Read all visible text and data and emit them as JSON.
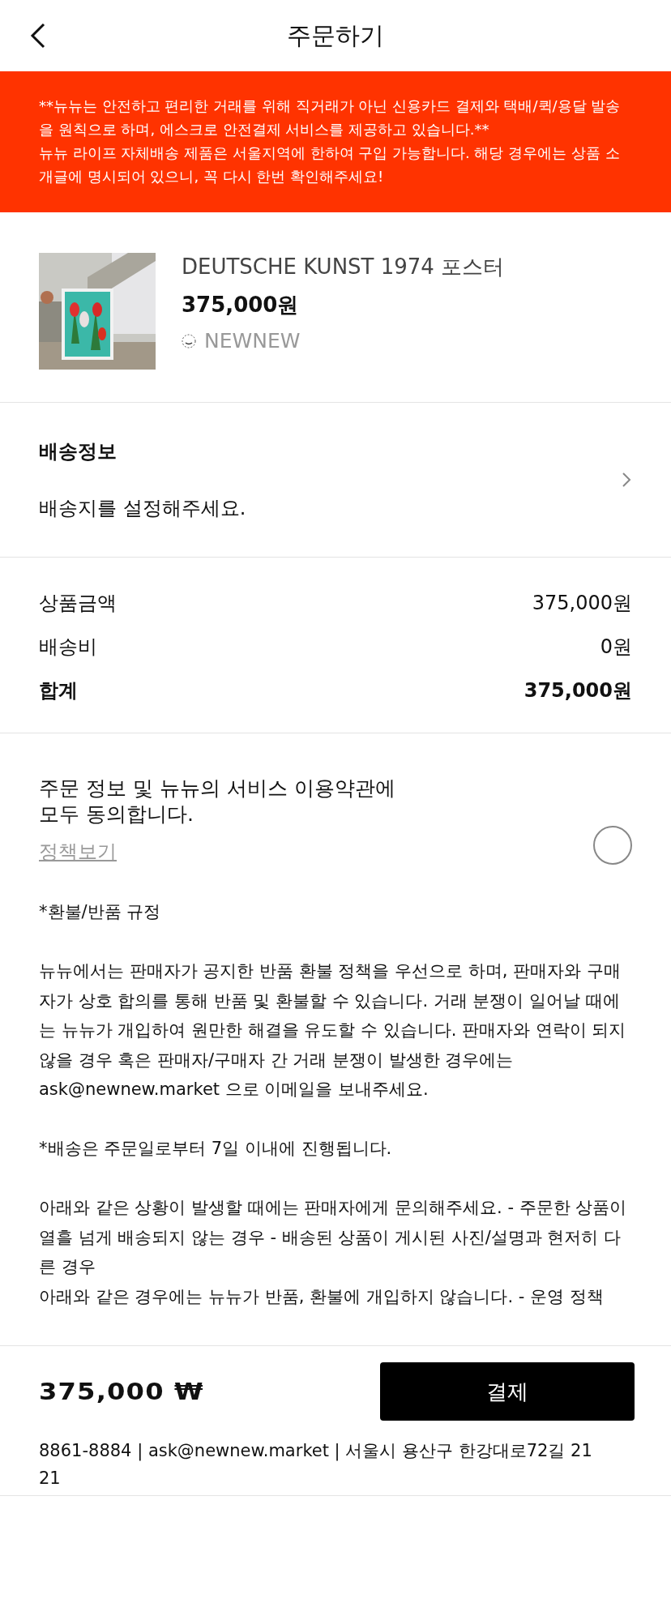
{
  "header": {
    "title": "주문하기"
  },
  "notice": [
    "**뉴뉴는 안전하고 편리한 거래를 위해 직거래가 아닌 신용카드 결제와 택배/퀵/용달 발송을 원칙으로 하며, 에스크로 안전결제 서비스를 제공하고 있습니다.**",
    "뉴뉴 라이프 자체배송 제품은 서울지역에 한하여 구입 가능합니다. 해당 경우에는 상품 소개글에 명시되어 있으니, 꼭 다시 한번 확인해주세요!"
  ],
  "product": {
    "name": "DEUTSCHE KUNST 1974 포스터",
    "price": "375,000원",
    "seller": "NEWNEW"
  },
  "shipping": {
    "title": "배송정보",
    "address_placeholder": "배송지를 설정해주세요."
  },
  "summary": [
    {
      "label": "상품금액",
      "value": "375,000원",
      "kind": "normal"
    },
    {
      "label": "배송비",
      "value": "0원",
      "kind": "normal"
    },
    {
      "label": "합계",
      "value": "375,000원",
      "kind": "total"
    }
  ],
  "agreement": {
    "text": "주문 정보 및 뉴뉴의 서비스 이용약관에\n모두 동의합니다.",
    "link": "정책보기",
    "checked": false
  },
  "terms": [
    "*환불/반품 규정",
    "뉴뉴에서는 판매자가 공지한 반품 환불 정책을 우선으로 하며, 판매자와 구매자가 상호 합의를 통해 반품 및 환불할 수 있습니다. 거래 분쟁이 일어날 때에는 뉴뉴가 개입하여 원만한 해결을 유도할 수 있습니다. 판매자와 연락이 되지 않을 경우 혹은 판매자/구매자 간 거래 분쟁이 발생한 경우에는 ask@newnew.market 으로 이메일을 보내주세요.",
    "*배송은 주문일로부터 7일 이내에 진행됩니다.",
    "아래와 같은 상황이 발생할 때에는 판매자에게 문의해주세요. - 주문한 상품이 열흘 넘게 배송되지 않는 경우 - 배송된 상품이 게시된 사진/설명과 현저히 다른 경우\n아래와 같은 경우에는 뉴뉴가 반품, 환불에 개입하지 않습니다. - 운영 정책"
  ],
  "bottom_bar": {
    "total": "375,000 ₩",
    "pay_button": "결제"
  },
  "footer": {
    "info": "8861-8884 | ask@newnew.market | 서울시 용산구 한강대로72길 21 21"
  }
}
